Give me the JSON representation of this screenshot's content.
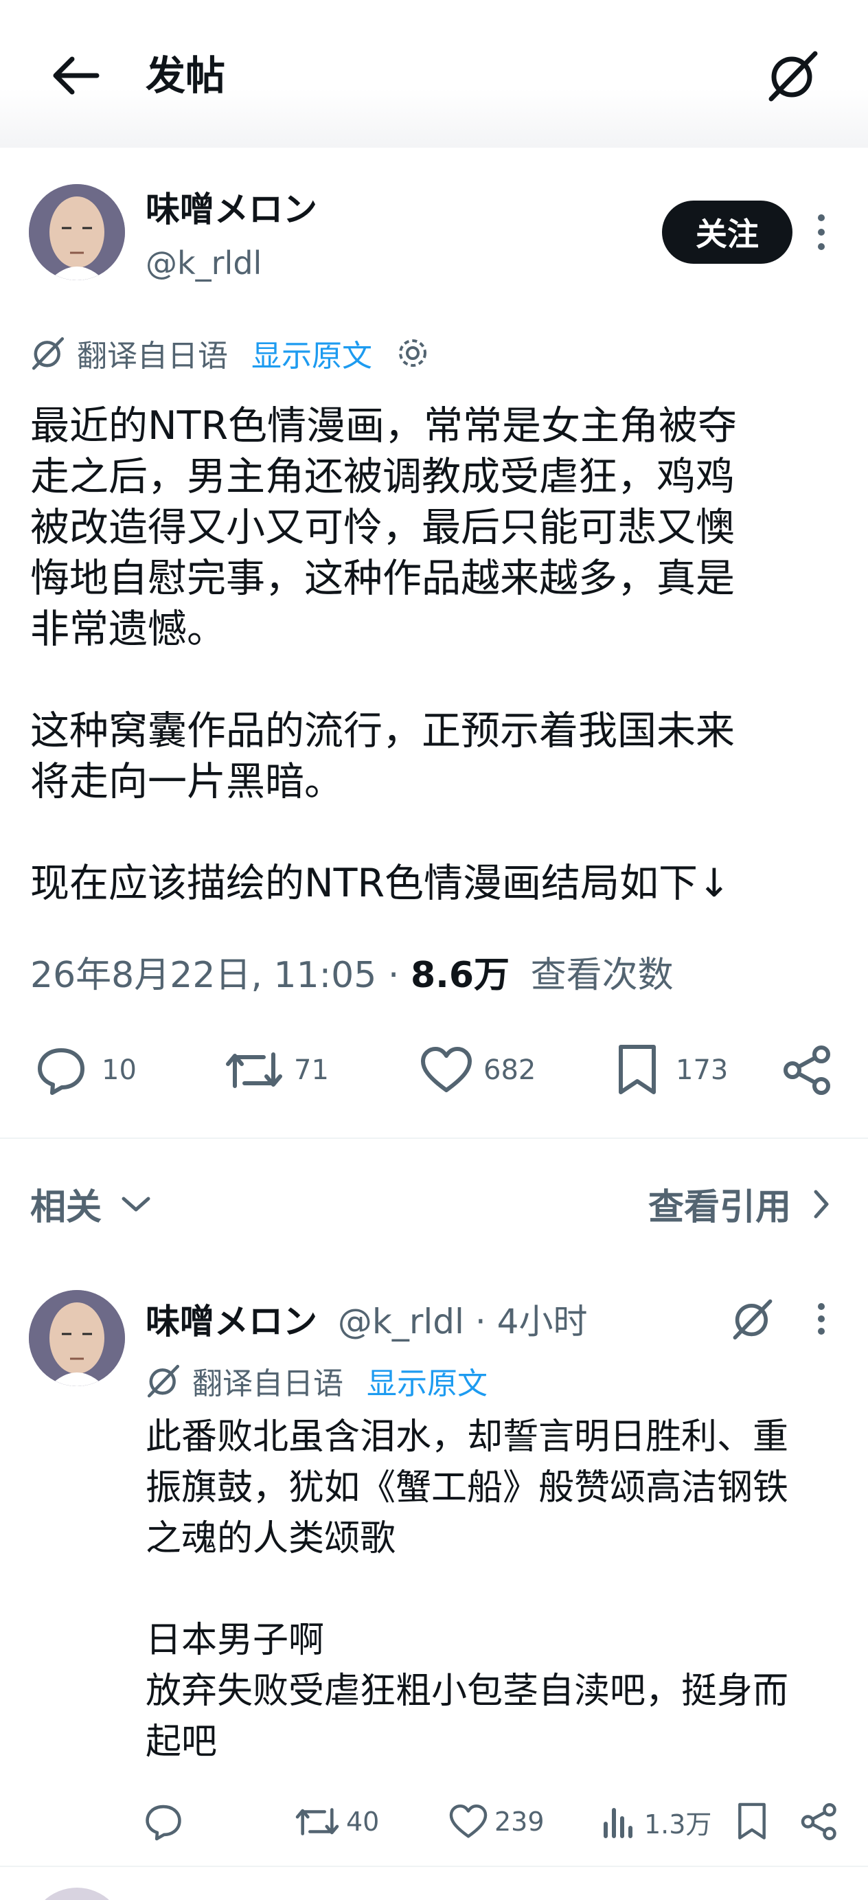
{
  "header": {
    "title": "发帖"
  },
  "post": {
    "author_name": "味噌メロン",
    "author_handle": "@k_rldl",
    "follow_label": "关注",
    "translate_label": "翻译自日语",
    "show_original": "显示原文",
    "body": "最近的NTR色情漫画，常常是女主角被夺\n走之后，男主角还被调教成受虐狂，鸡鸡\n被改造得又小又可怜，最后只能可悲又懊\n悔地自慰完事，这种作品越来越多，真是\n非常遗憾。\n\n这种窝囊作品的流行，正预示着我国未来\n将走向一片黑暗。\n\n现在应该描绘的NTR色情漫画结局如下↓",
    "timestamp": "26年8月22日, 11:05",
    "views_count": "8.6万",
    "views_label": "查看次数",
    "replies": "10",
    "retweets": "71",
    "likes": "682",
    "bookmarks": "173"
  },
  "related": {
    "label": "相关",
    "view_quotes": "查看引用"
  },
  "reply": {
    "author_name": "味噌メロン",
    "author_handle": "@k_rldl",
    "time": "· 4小时",
    "translate_label": "翻译自日语",
    "show_original": "显示原文",
    "body": "此番败北虽含泪水，却誓言明日胜利、重\n振旗鼓，犹如《蟹工船》般赞颂高洁钢铁\n之魂的人类颂歌\n\n日本男子啊\n放弃失败受虐狂粗小包茎自渎吧，挺身而\n起吧",
    "retweets": "40",
    "likes": "239",
    "views": "1.3万"
  },
  "colors": {
    "text": "#0f1419",
    "secondary": "#536471",
    "link": "#1d9bf0"
  }
}
